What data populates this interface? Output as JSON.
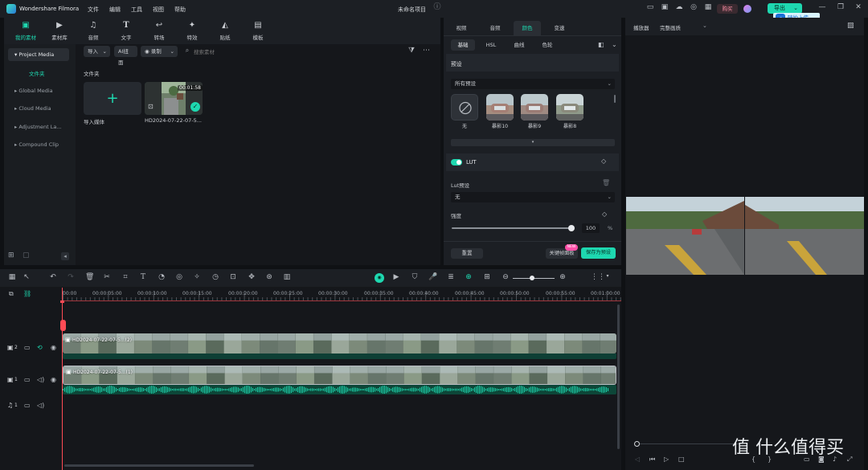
{
  "titlebar": {
    "app_name": "Wondershare Filmora",
    "menus": [
      "文件",
      "编辑",
      "工具",
      "视图",
      "帮助"
    ],
    "project_name": "未命名项目",
    "buy_label": "购买",
    "export_label": "导出",
    "upload_tip": "随拍上传"
  },
  "toolbar_tabs": [
    {
      "label": "我的素材",
      "icon": "media-icon"
    },
    {
      "label": "素材库",
      "icon": "stock-icon"
    },
    {
      "label": "音频",
      "icon": "music-icon"
    },
    {
      "label": "文字",
      "icon": "text-icon"
    },
    {
      "label": "转场",
      "icon": "transition-icon"
    },
    {
      "label": "特效",
      "icon": "effects-icon"
    },
    {
      "label": "贴纸",
      "icon": "sticker-icon"
    },
    {
      "label": "模板",
      "icon": "template-icon"
    }
  ],
  "sidebar": {
    "items": [
      {
        "label": "Project Media"
      },
      {
        "label": "Global Media"
      },
      {
        "label": "Cloud Media"
      },
      {
        "label": "Adjustment La..."
      },
      {
        "label": "Compound Clip"
      }
    ],
    "folder_label": "文件夹"
  },
  "media_toolbar": {
    "import_label": "导入",
    "ai_label": "AI扭面",
    "record_label": "录制",
    "search_placeholder": "搜索素材"
  },
  "media": {
    "folder_title": "文件夹",
    "import_tile_label": "导入媒体",
    "clip_name": "HD2024-07-22-07-5...",
    "clip_duration": "00:01:58"
  },
  "properties": {
    "tabs": [
      "视频",
      "音频",
      "颜色",
      "变速"
    ],
    "active_tab": "颜色",
    "subtabs": [
      "基础",
      "HSL",
      "曲线",
      "色轮"
    ],
    "preset_section": "预设",
    "preset_select": "所有预设",
    "presets": [
      {
        "label": "无"
      },
      {
        "label": "暴影10"
      },
      {
        "label": "暴影9"
      },
      {
        "label": "暴影8"
      }
    ],
    "lut_section": "LUT",
    "lut_preset_label": "Lut预设",
    "lut_preset_value": "无",
    "strength_label": "强度",
    "strength_value": "100",
    "strength_unit": "%",
    "reset_label": "重置",
    "keyframe_label": "关键帧面板",
    "new_badge": "NEW",
    "save_preset_label": "保存为预设"
  },
  "player": {
    "label": "播放器",
    "quality": "完整画质"
  },
  "timeline": {
    "ticks": [
      "00:00",
      "00:00:05:00",
      "00:00:10:00",
      "00:00:15:00",
      "00:00:20:00",
      "00:00:25:00",
      "00:00:30:00",
      "00:00:35:00",
      "00:00:40:00",
      "00:00:45:00",
      "00:00:50:00",
      "00:00:55:00",
      "00:01:00:00"
    ],
    "clip2_label": "HD2024-07-22-07-5...(2)",
    "clip1_label": "HD2024-07-22-07-5...(1)",
    "track2_num": "2",
    "track1_num": "1",
    "audio_track_num": "1"
  },
  "watermark": "值 什么值得买"
}
